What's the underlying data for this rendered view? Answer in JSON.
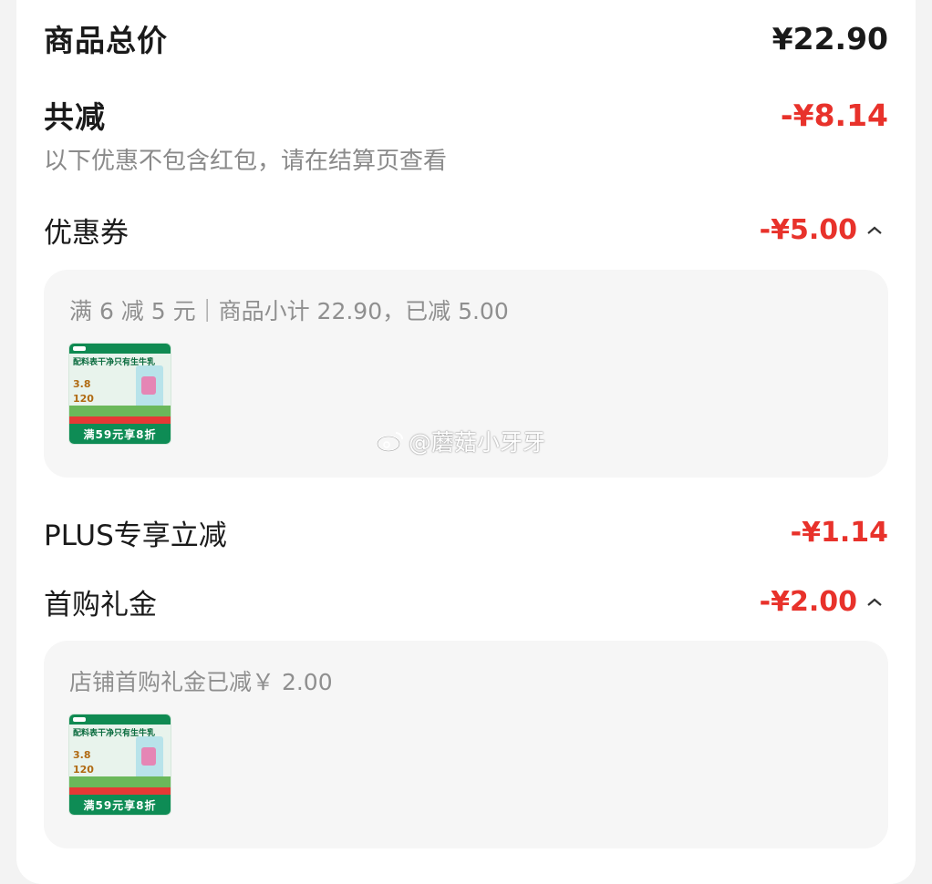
{
  "summary": {
    "total_label": "商品总价",
    "total_value": "¥22.90",
    "discount_label": "共减",
    "discount_value": "-¥8.14",
    "note": "以下优惠不包含红包，请在结算页查看"
  },
  "coupon": {
    "label": "优惠券",
    "value": "-¥5.00",
    "detail": "满 6 减 5 元｜商品小计 22.90，已减 5.00",
    "product": {
      "headline": "配料表干净只有生牛乳",
      "stat1": "3.8",
      "stat2": "120",
      "promo": "满59元享8折"
    }
  },
  "plus": {
    "label": "PLUS专享立减",
    "value": "-¥1.14"
  },
  "gift": {
    "label": "首购礼金",
    "value": "-¥2.00",
    "detail": "店铺首购礼金已减￥ 2.00",
    "product": {
      "headline": "配料表干净只有生牛乳",
      "stat1": "3.8",
      "stat2": "120",
      "promo": "满59元享8折"
    }
  },
  "watermark": "@蘑菇小牙牙",
  "colors": {
    "accent_red": "#e8322b",
    "brand_green": "#0e8c55"
  }
}
